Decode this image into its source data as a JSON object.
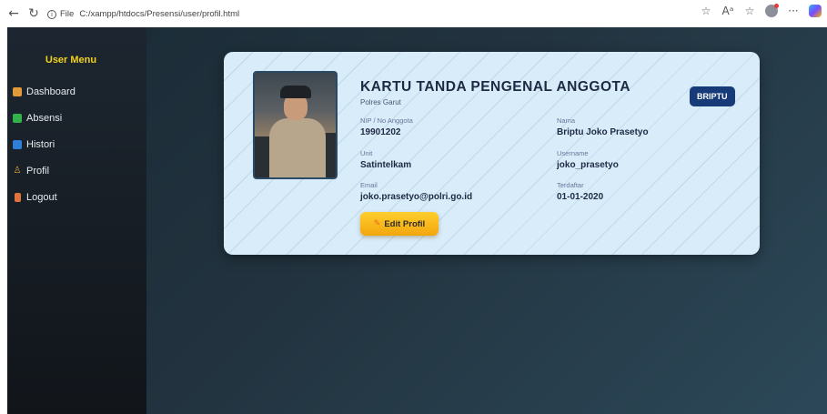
{
  "browser": {
    "scheme_label": "File",
    "url": "C:/xampp/htdocs/Presensi/user/profil.html",
    "icons": [
      "back-icon",
      "reload-icon",
      "info-icon",
      "favorite-star-icon",
      "read-aloud-icon",
      "favorites-icon",
      "profile-icon",
      "more-icon",
      "copilot-icon"
    ]
  },
  "sidebar": {
    "title": "User Menu",
    "items": [
      {
        "label": "Dashboard",
        "icon": "house-icon"
      },
      {
        "label": "Absensi",
        "icon": "check-box-icon"
      },
      {
        "label": "Histori",
        "icon": "card-icon"
      },
      {
        "label": "Profil",
        "icon": "user-icon"
      },
      {
        "label": "Logout",
        "icon": "door-icon"
      }
    ]
  },
  "card": {
    "title": "KARTU TANDA PENGENAL ANGGOTA",
    "subtitle": "Polres Garut",
    "rank": "BRIPTU",
    "fields": {
      "nip": {
        "label": "NIP / No Anggota",
        "value": "19901202"
      },
      "nama": {
        "label": "Nama",
        "value": "Briptu Joko Prasetyo"
      },
      "unit": {
        "label": "Unit",
        "value": "Satintelkam"
      },
      "username": {
        "label": "Username",
        "value": "joko_prasetyo"
      },
      "email": {
        "label": "Email",
        "value": "joko.prasetyo@polri.go.id"
      },
      "terdaftar": {
        "label": "Terdaftar",
        "value": "01-01-2020"
      }
    },
    "edit_button": "Edit Profil"
  },
  "colors": {
    "accent": "#f2d21e",
    "card_bg": "#d8ecfa",
    "badge_bg": "#173a78",
    "button": "#f2a60c"
  }
}
